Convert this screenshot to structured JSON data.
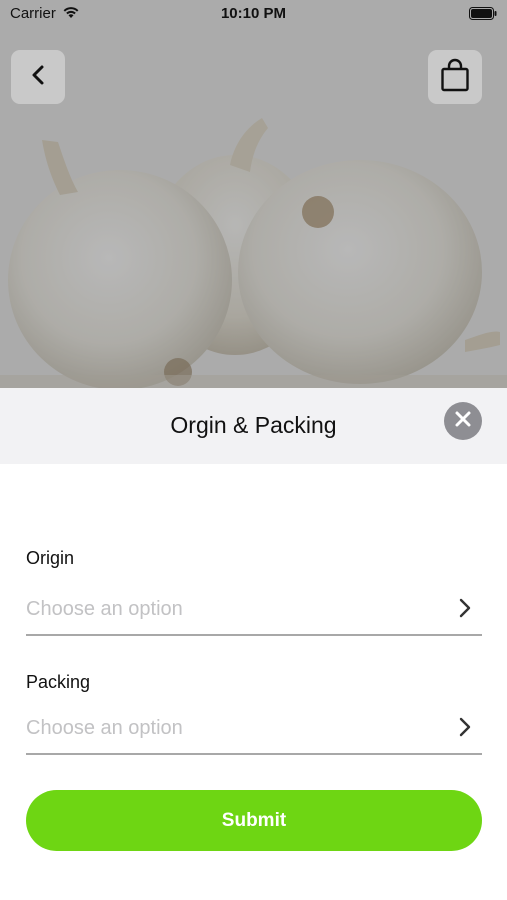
{
  "status_bar": {
    "carrier": "Carrier",
    "time": "10:10 PM"
  },
  "hero": {
    "image": "white-onions-photo",
    "back_icon": "chevron-left-icon",
    "bag_icon": "shopping-bag-icon"
  },
  "sheet": {
    "title": "Orgin & Packing",
    "close_icon": "close-icon",
    "fields": [
      {
        "label": "Origin",
        "placeholder": "Choose an option",
        "icon": "chevron-right-icon"
      },
      {
        "label": "Packing",
        "placeholder": "Choose an option",
        "icon": "chevron-right-icon"
      }
    ],
    "submit_label": "Submit"
  },
  "colors": {
    "accent": "#6ed613",
    "sheet_header_bg": "#f2f2f4",
    "close_button": "#8e8e93",
    "placeholder": "#c2c2c4"
  }
}
